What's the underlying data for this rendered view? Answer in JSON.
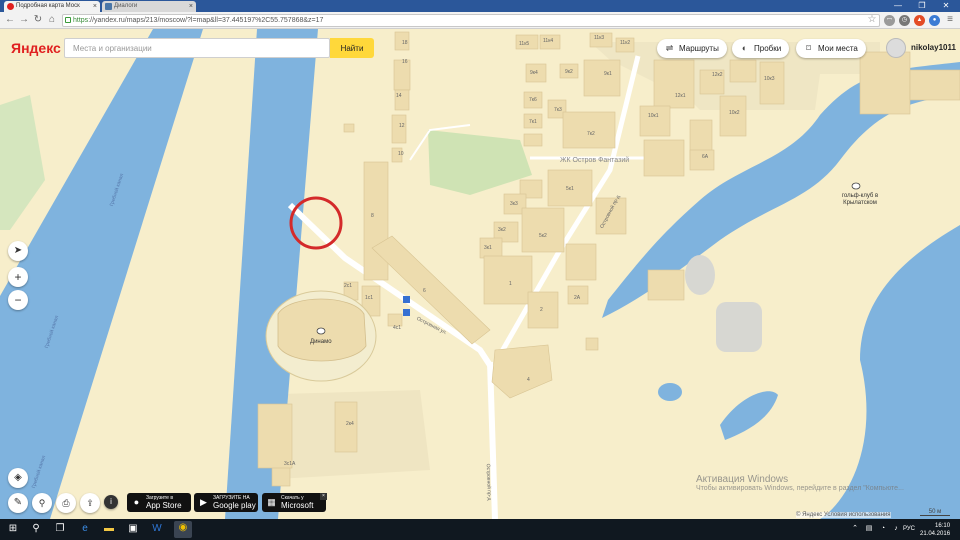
{
  "browser": {
    "tabs": [
      {
        "title": "Подробная карта Моск",
        "active": true
      },
      {
        "title": "Диалоги",
        "active": false
      }
    ],
    "url_scheme": "https",
    "url_rest": "://yandex.ru/maps/213/moscow/?l=map&ll=37.445197%2C55.757868&z=17",
    "window_controls": [
      "—",
      "❐",
      "✕"
    ]
  },
  "map_ui": {
    "logo": "Яндекс",
    "search": {
      "placeholder": "Места и организации",
      "button": "Найти"
    },
    "top_buttons": {
      "routes": "Маршруты",
      "traffic": "Пробки",
      "places": "Мои места"
    },
    "user": {
      "name": "nikolay1011"
    },
    "zoom": {
      "in": "+",
      "out": "−"
    },
    "stores": [
      {
        "small": "Загрузите в",
        "big": "App Store"
      },
      {
        "small": "ЗАГРУЗИТЕ НА",
        "big": "Google play"
      },
      {
        "small": "Скачать у",
        "big": "Microsoft"
      }
    ],
    "copyright": "© Яндекс Условия использования",
    "scale": "50 м"
  },
  "map_labels": {
    "complex": "ЖК Остров Фантазий",
    "golf": "гольф-клуб в Крылатском",
    "dinamo": "Динамо",
    "street1": "Островная ул.",
    "street2": "Островной пр-д",
    "street3": "Островной пр-д",
    "rowing1": "Гребной канал",
    "rowing2": "Гребной канал",
    "rowing3": "Гребной канал",
    "buildings": [
      "11к5",
      "11к4",
      "11к3",
      "11к2",
      "9к4",
      "9к1",
      "9к2",
      "7к6",
      "7к3",
      "7к1",
      "7к5",
      "7к2",
      "5к1",
      "5к2",
      "3к3",
      "3к2",
      "3к1",
      "3к4",
      "1к2",
      "1",
      "2",
      "2А",
      "4",
      "6",
      "8",
      "10",
      "12",
      "12к1",
      "12к2",
      "10к3",
      "10к1",
      "10к2",
      "6А",
      "14",
      "16",
      "18",
      "2к4",
      "3с1А",
      "1с1",
      "2с1",
      "4с1"
    ]
  },
  "activation": {
    "title": "Активация Windows",
    "subtitle": "Чтобы активировать Windows, перейдите в раздел \"Компьюте..."
  },
  "taskbar": {
    "lang": "РУС",
    "time": "16:10",
    "date": "21.04.2016"
  },
  "colors": {
    "land": "#f7eecb",
    "water": "#7fb3de",
    "green": "#d5e6be",
    "building": "#eddcae",
    "road": "#ffffff",
    "circle": "#d42a2a"
  }
}
